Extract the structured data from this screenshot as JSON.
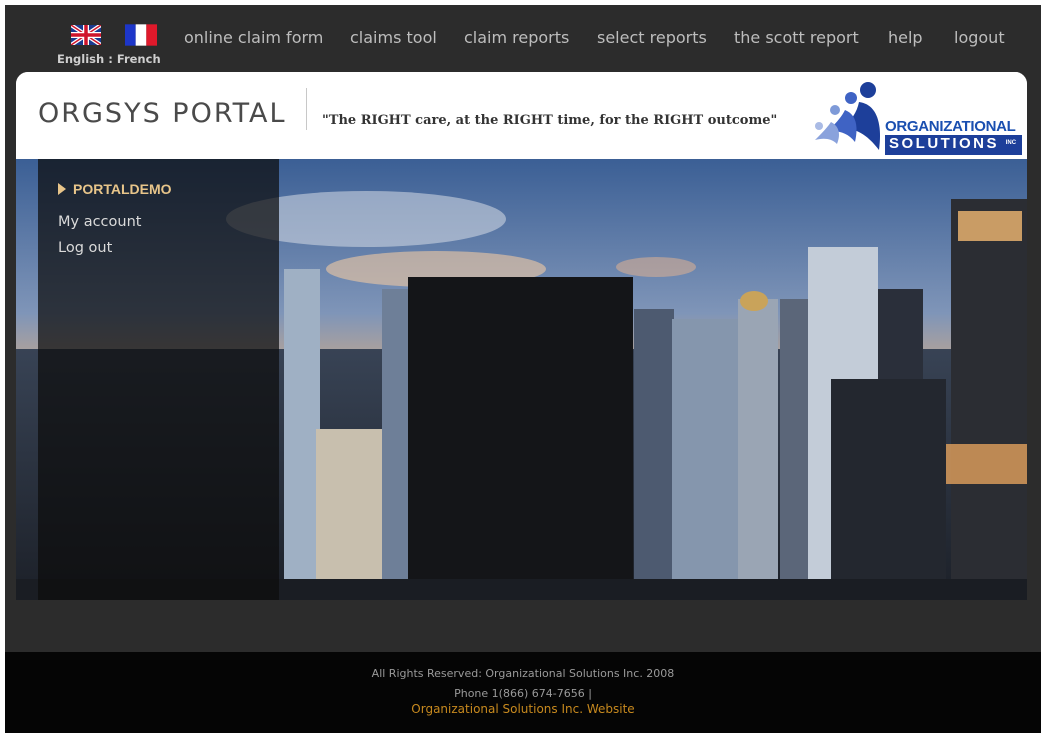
{
  "languages": {
    "english_label": "English",
    "separator": ":",
    "french_label": "French",
    "english_flag_icon": "uk-flag-icon",
    "french_flag_icon": "france-flag-icon"
  },
  "nav": {
    "items": [
      {
        "label": "online claim form"
      },
      {
        "label": "claims tool"
      },
      {
        "label": "claim reports"
      },
      {
        "label": "select reports"
      },
      {
        "label": "the scott report"
      },
      {
        "label": "help"
      },
      {
        "label": "logout"
      }
    ]
  },
  "header": {
    "title": "ORGSYS PORTAL",
    "tagline": "\"The RIGHT care, at the RIGHT time, for the RIGHT outcome\"",
    "logo": {
      "line1": "ORGANIZATIONAL",
      "line2": "SOLUTIONS",
      "suffix": "INC"
    }
  },
  "sidebar": {
    "user": "PORTALDEMO",
    "links": [
      "My account",
      "Log out"
    ]
  },
  "footer": {
    "rights": "All Rights Reserved: Organizational Solutions Inc. 2008",
    "phone": "Phone 1(866) 674-7656 |",
    "website_link": "Organizational Solutions Inc. Website"
  },
  "colors": {
    "page_bg": "#2c2c2c",
    "footer_bg": "#050505",
    "nav_text": "#bdbdbd",
    "sidebar_heading": "#e8c58a",
    "link_orange": "#c7891e",
    "brand_blue": "#1d3f9a"
  }
}
